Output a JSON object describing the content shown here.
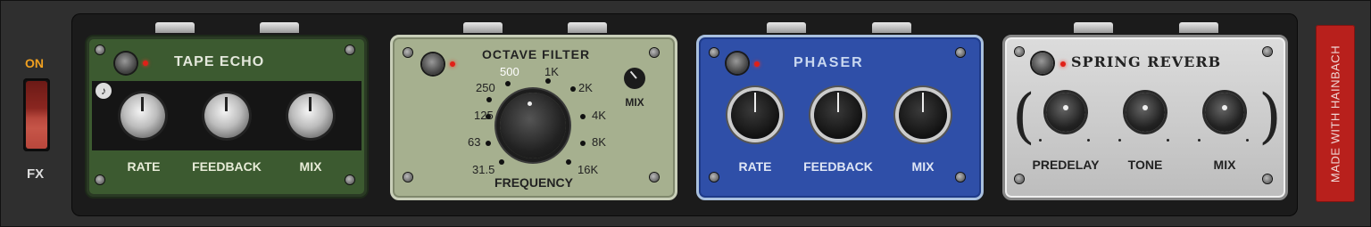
{
  "fx_switch": {
    "on_label": "ON",
    "fx_label": "FX",
    "state": "on"
  },
  "pedals": {
    "tape_echo": {
      "title": "TAPE ECHO",
      "knobs": [
        "RATE",
        "FEEDBACK",
        "MIX"
      ],
      "sync_icon": "note-icon"
    },
    "octave_filter": {
      "title": "OCTAVE FILTER",
      "frequency_label": "FREQUENCY",
      "mix_label": "MIX",
      "frequencies": [
        "31.5",
        "63",
        "125",
        "250",
        "500",
        "1K",
        "2K",
        "4K",
        "8K",
        "16K"
      ],
      "selected_frequency": "500"
    },
    "phaser": {
      "title": "PHASER",
      "knobs": [
        "RATE",
        "FEEDBACK",
        "MIX"
      ]
    },
    "spring_reverb": {
      "title": "SPRING REVERB",
      "knobs": [
        "PREDELAY",
        "TONE",
        "MIX"
      ]
    }
  },
  "credit": {
    "label": "MADE WITH HAINBACH"
  },
  "colors": {
    "tape_echo": "#3c5a30",
    "octave_filter": "#a6b08f",
    "phaser": "#2f4fa8",
    "spring_reverb": "#cfcfcf",
    "credit": "#b8201c",
    "on_label": "#f0a020",
    "led": "#e02018"
  }
}
